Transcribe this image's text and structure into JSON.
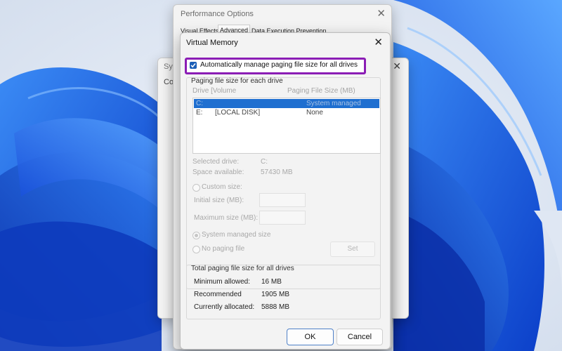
{
  "performance_options": {
    "title": "Performance Options",
    "tabs": [
      "Visual Effects",
      "Advanced",
      "Data Execution Prevention"
    ]
  },
  "system_properties": {
    "title_fragment": "Syst",
    "inner_fragment": "Co"
  },
  "virtual_memory": {
    "title": "Virtual Memory",
    "auto_manage_label": "Automatically manage paging file size for all drives",
    "auto_manage_checked": true,
    "paging_group_title": "Paging file size for each drive",
    "columns": [
      "Drive  [Volume",
      "Paging File Size (MB)"
    ],
    "drives": [
      {
        "drive": "C:",
        "volume": "",
        "size": "System managed",
        "selected": true
      },
      {
        "drive": "E:",
        "volume": "[LOCAL DISK]",
        "size": "None",
        "selected": false
      }
    ],
    "selected_drive_label": "Selected drive:",
    "selected_drive_value": "C:",
    "space_available_label": "Space available:",
    "space_available_value": "57430 MB",
    "custom_size_label": "Custom size:",
    "initial_size_label": "Initial size (MB):",
    "maximum_size_label": "Maximum size (MB):",
    "system_managed_label": "System managed size",
    "no_paging_label": "No paging file",
    "set_button": "Set",
    "totals_title": "Total paging file size for all drives",
    "totals": [
      {
        "label": "Minimum allowed:",
        "value": "16 MB"
      },
      {
        "label": "Recommended",
        "value": "1905 MB"
      },
      {
        "label": "Currently allocated:",
        "value": "5888 MB"
      }
    ],
    "ok_button": "OK",
    "cancel_button": "Cancel"
  },
  "icons": {
    "close": "close-icon",
    "checkmark": "checkmark-icon"
  },
  "colors": {
    "highlight_border": "#8b1db5",
    "selection": "#1f6fd0",
    "checkbox": "#1c5fb7"
  }
}
